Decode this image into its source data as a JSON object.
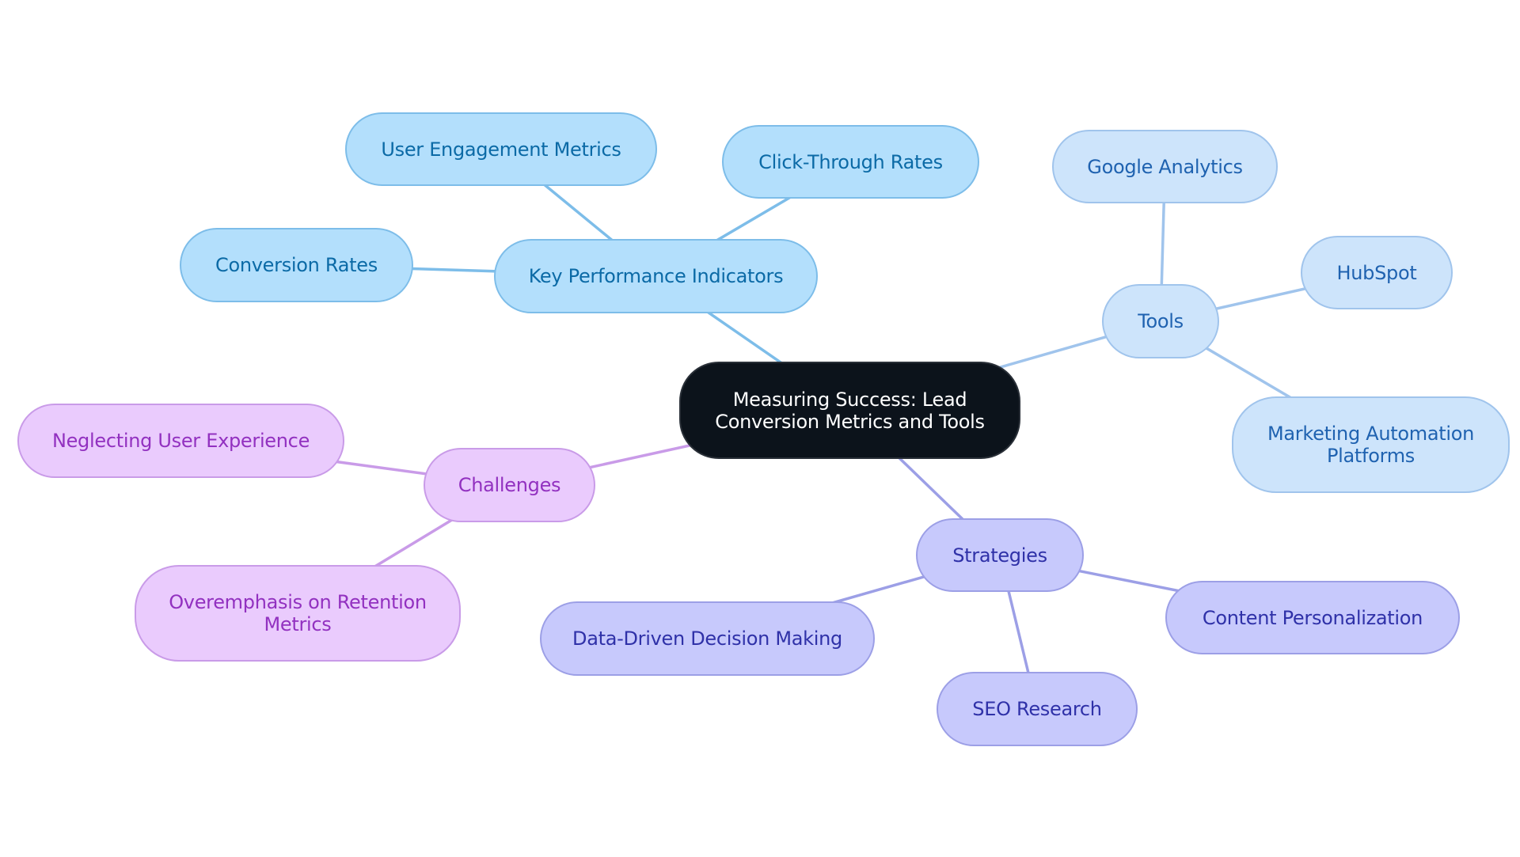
{
  "diagram": {
    "type": "mind-map",
    "root": {
      "id": "root",
      "label": "Measuring Success: Lead\nConversion Metrics and Tools",
      "color": "#0c131b"
    },
    "branches": [
      {
        "id": "kpi",
        "label": "Key Performance Indicators",
        "color": "#b3dffc",
        "edge_color": "#7dbde9",
        "children": [
          {
            "id": "kpi-1",
            "label": "User Engagement Metrics"
          },
          {
            "id": "kpi-2",
            "label": "Click-Through Rates"
          },
          {
            "id": "kpi-3",
            "label": "Conversion Rates"
          }
        ]
      },
      {
        "id": "tools",
        "label": "Tools",
        "color": "#cde4fb",
        "edge_color": "#a0c4ec",
        "children": [
          {
            "id": "tools-1",
            "label": "Google Analytics"
          },
          {
            "id": "tools-2",
            "label": "HubSpot"
          },
          {
            "id": "tools-3",
            "label": "Marketing Automation\nPlatforms"
          }
        ]
      },
      {
        "id": "strat",
        "label": "Strategies",
        "color": "#c7c9fc",
        "edge_color": "#9c9fe6",
        "children": [
          {
            "id": "strat-1",
            "label": "Content Personalization"
          },
          {
            "id": "strat-2",
            "label": "SEO Research"
          },
          {
            "id": "strat-3",
            "label": "Data-Driven Decision Making"
          }
        ]
      },
      {
        "id": "chal",
        "label": "Challenges",
        "color": "#eacbfd",
        "edge_color": "#c99be8",
        "children": [
          {
            "id": "chal-1",
            "label": "Neglecting User Experience"
          },
          {
            "id": "chal-2",
            "label": "Overemphasis on Retention\nMetrics"
          }
        ]
      }
    ]
  }
}
